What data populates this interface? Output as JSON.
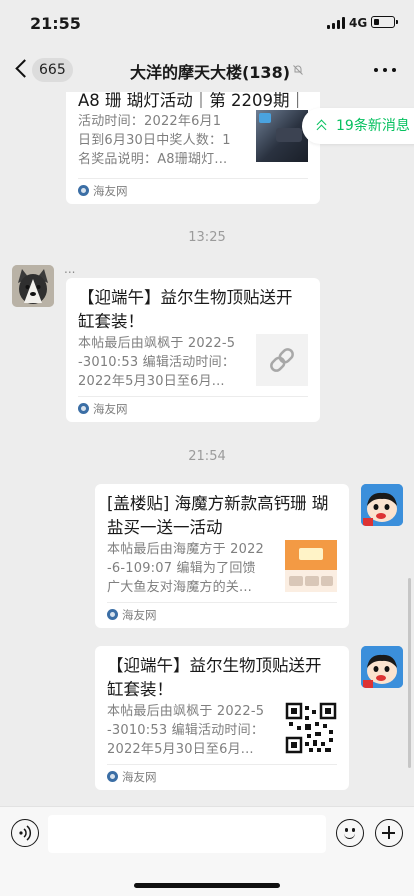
{
  "status_bar": {
    "time": "21:55",
    "network": "4G",
    "battery_level": 0.25
  },
  "nav": {
    "back_count": "665",
    "title": "大洋的摩天大楼(138)"
  },
  "new_messages": "19条新消息",
  "messages": [
    {
      "type": "card",
      "title": "A8 珊 瑚灯活动｜第 2209期｜",
      "desc": [
        "活动时间：2022年6月1",
        "日到6月30日中奖人数：1",
        "名奖品说明：A8珊瑚灯..."
      ],
      "source": "海友网",
      "thumb": "aquarium-photo"
    },
    {
      "type": "time",
      "text": "13:25"
    },
    {
      "type": "card",
      "sender": "...",
      "title": [
        "【迎端午】益尔生物顶贴送开",
        "缸套装！"
      ],
      "desc": [
        "本帖最后由飒枫于 2022-5",
        "-3010:53 编辑活动时间：",
        "2022年5月30日至6月..."
      ],
      "source": "海友网",
      "thumb": "link-icon"
    },
    {
      "type": "time",
      "text": "21:54"
    },
    {
      "type": "card",
      "title": [
        "[盖楼贴] 海魔方新款高钙珊 瑚",
        "盐买一送一活动"
      ],
      "desc": [
        "本帖最后由海魔方于 2022",
        "-6-109:07 编辑为了回馈",
        "广大鱼友对海魔方的关..."
      ],
      "source": "海友网",
      "thumb": "promo-banner"
    },
    {
      "type": "card",
      "title": [
        "【迎端午】益尔生物顶贴送开",
        "缸套装！"
      ],
      "desc": [
        "本帖最后由飒枫于 2022-5",
        "-3010:53 编辑活动时间：",
        "2022年5月30日至6月..."
      ],
      "source": "海友网",
      "thumb": "qr-code"
    }
  ]
}
